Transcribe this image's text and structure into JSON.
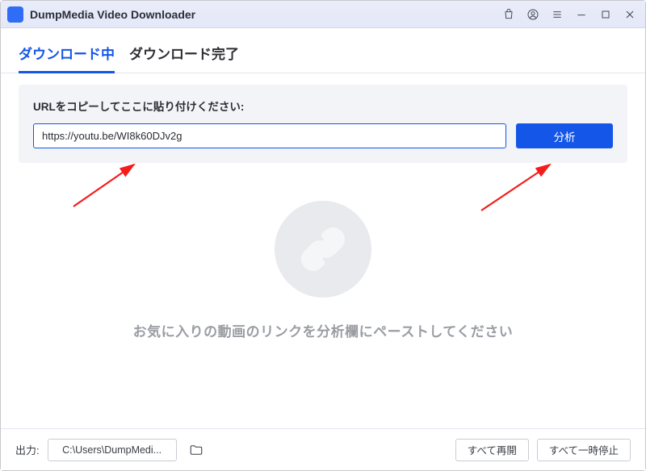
{
  "app": {
    "title": "DumpMedia Video Downloader"
  },
  "tabs": {
    "downloading": "ダウンロード中",
    "downloaded": "ダウンロード完了"
  },
  "urlPanel": {
    "label": "URLをコピーしてここに貼り付けください:",
    "value": "https://youtu.be/WI8k60DJv2g",
    "analyzeLabel": "分析"
  },
  "empty": {
    "message": "お気に入りの動画のリンクを分析欄にペーストしてください"
  },
  "footer": {
    "outputLabel": "出力:",
    "path": "C:\\Users\\DumpMedi...",
    "resumeAll": "すべて再開",
    "pauseAll": "すべて一時停止"
  }
}
